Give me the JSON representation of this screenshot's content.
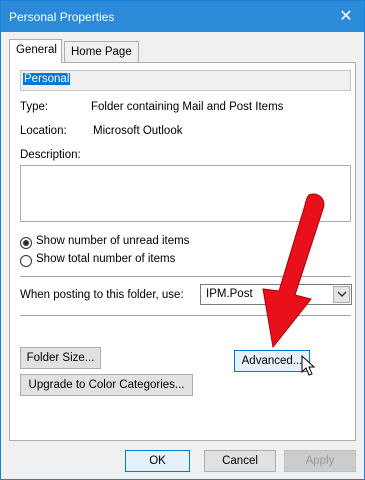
{
  "window": {
    "title": "Personal Properties",
    "close_glyph": "✕"
  },
  "tabs": [
    {
      "label": "General",
      "active": true
    },
    {
      "label": "Home Page",
      "active": false
    }
  ],
  "general": {
    "name_value": "Personal",
    "type_label": "Type:",
    "type_value": "Folder containing Mail and Post Items",
    "location_label": "Location:",
    "location_value": "Microsoft Outlook",
    "description_label": "Description:",
    "description_value": "",
    "radio_options": [
      {
        "label": "Show number of unread items",
        "checked": true
      },
      {
        "label": "Show total number of items",
        "checked": false
      }
    ],
    "posting_label": "When posting to this folder, use:",
    "posting_value": "IPM.Post",
    "folder_size_button": "Folder Size...",
    "advanced_button": "Advanced...",
    "upgrade_button": "Upgrade to Color Categories..."
  },
  "footer": {
    "ok": "OK",
    "cancel": "Cancel",
    "apply": "Apply"
  },
  "colors": {
    "titlebar": "#2b8bd8",
    "selection": "#0078d7",
    "arrow": "#e8101a"
  },
  "icons": [
    "close-icon",
    "chevron-down-icon",
    "red-arrow-icon",
    "mouse-cursor-icon"
  ]
}
